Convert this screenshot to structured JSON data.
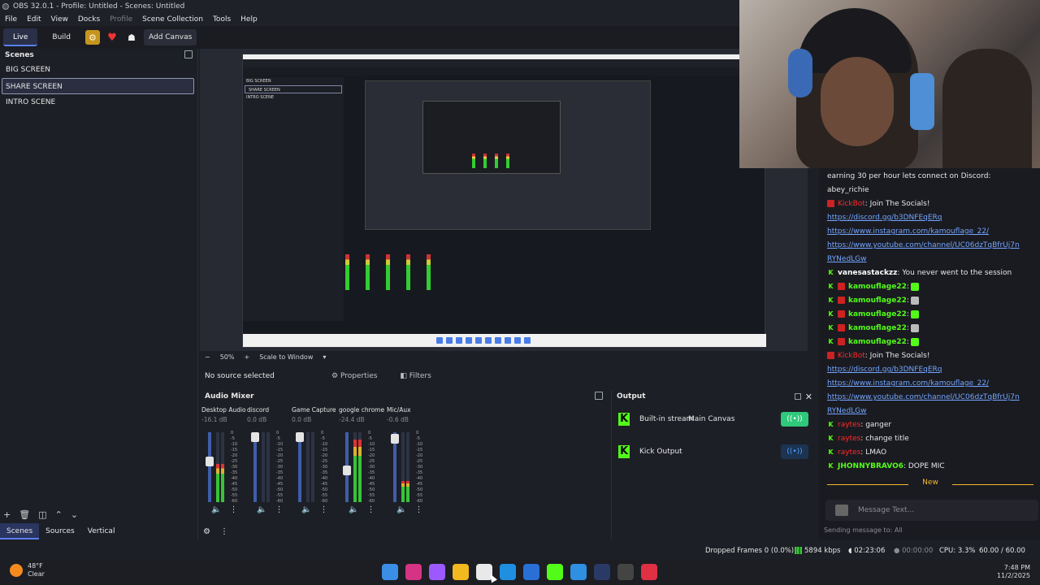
{
  "window": {
    "title": "OBS 32.0.1 - Profile: Untitled - Scenes: Untitled"
  },
  "menu": [
    "File",
    "Edit",
    "View",
    "Docks",
    "Profile",
    "Scene Collection",
    "Tools",
    "Help"
  ],
  "modes": {
    "live": "Live",
    "build": "Build",
    "add_canvas": "Add Canvas"
  },
  "scenes": {
    "header": "Scenes",
    "items": [
      "BIG SCREEN",
      "SHARE SCREEN",
      "INTRO SCENE"
    ],
    "selected_index": 1
  },
  "dock_tabs": [
    "Scenes",
    "Sources",
    "Vertical"
  ],
  "preview": {
    "zoom": "50%",
    "scale_mode": "Scale to Window",
    "nested_scenes": [
      "BIG SCREEN",
      "SHARE SCREEN",
      "INTRO SCENE"
    ]
  },
  "source_bar": {
    "no_source": "No source selected",
    "properties": "Properties",
    "filters": "Filters"
  },
  "mixer": {
    "header": "Audio Mixer",
    "channels": [
      {
        "name": "Desktop Audio",
        "db": "-16.1 dB",
        "level": 0.55,
        "fader": 0.6
      },
      {
        "name": "discord",
        "db": "0.0 dB",
        "level": 0.0,
        "fader": 1.0
      },
      {
        "name": "Game Capture",
        "db": "0.0 dB",
        "level": 0.0,
        "fader": 1.0
      },
      {
        "name": "google chrome",
        "db": "-24.4 dB",
        "level": 0.9,
        "fader": 0.45
      },
      {
        "name": "Mic/Aux",
        "db": "-0.6 dB",
        "level": 0.3,
        "fader": 0.97
      }
    ],
    "scale": [
      "0",
      "-5",
      "-10",
      "-15",
      "-20",
      "-25",
      "-30",
      "-35",
      "-40",
      "-45",
      "-50",
      "-55",
      "-60"
    ]
  },
  "output": {
    "header": "Output",
    "rows": [
      {
        "name": "Built-in stream",
        "canvas": "Main Canvas",
        "state": "on"
      },
      {
        "name": "Kick Output",
        "canvas": "",
        "state": "off"
      }
    ]
  },
  "chat": {
    "lines": [
      {
        "kind": "text",
        "text": "earning 30 per hour lets connect on Discord:"
      },
      {
        "kind": "text",
        "text": "abey_richie"
      },
      {
        "kind": "msg",
        "badge": "bot",
        "user": "KickBot",
        "ucolor": "user-red",
        "text": ": Join The Socials!"
      },
      {
        "kind": "link",
        "text": "https://discord.gg/b3DNFEqERq"
      },
      {
        "kind": "link",
        "text": "https://www.instagram.com/kamouflage_22/"
      },
      {
        "kind": "link",
        "text": "https://www.youtube.com/channel/UC06dzTqBfrUj7n"
      },
      {
        "kind": "link",
        "text": "RYNedLGw"
      },
      {
        "kind": "msg",
        "badge": "k",
        "user": "vanesastackzz",
        "ucolor": "user-white",
        "text": ": You never went to the session"
      },
      {
        "kind": "msg",
        "badge": "kb",
        "user": "kamouflage22",
        "ucolor": "user-green",
        "text": ":",
        "emote": "green"
      },
      {
        "kind": "msg",
        "badge": "kb",
        "user": "kamouflage22",
        "ucolor": "user-green",
        "text": ":",
        "emote": "gray"
      },
      {
        "kind": "msg",
        "badge": "kb",
        "user": "kamouflage22",
        "ucolor": "user-green",
        "text": ":",
        "emote": "green"
      },
      {
        "kind": "msg",
        "badge": "kb",
        "user": "kamouflage22",
        "ucolor": "user-green",
        "text": ":",
        "emote": "gray"
      },
      {
        "kind": "msg",
        "badge": "kb",
        "user": "kamouflage22",
        "ucolor": "user-green",
        "text": ":",
        "emote": "green"
      },
      {
        "kind": "msg",
        "badge": "bot",
        "user": "KickBot",
        "ucolor": "user-red",
        "text": ": Join The Socials!"
      },
      {
        "kind": "link",
        "text": "https://discord.gg/b3DNFEqERq"
      },
      {
        "kind": "link",
        "text": "https://www.instagram.com/kamouflage_22/"
      },
      {
        "kind": "link",
        "text": "https://www.youtube.com/channel/UC06dzTqBfrUj7n"
      },
      {
        "kind": "link",
        "text": "RYNedLGw"
      },
      {
        "kind": "msg",
        "badge": "k",
        "user": "raytes",
        "ucolor": "user-red",
        "text": ": ganger"
      },
      {
        "kind": "msg",
        "badge": "k",
        "user": "raytes",
        "ucolor": "user-red",
        "text": ": change title"
      },
      {
        "kind": "msg",
        "badge": "k",
        "user": "raytes",
        "ucolor": "user-red",
        "text": ": LMAO"
      },
      {
        "kind": "msg",
        "badge": "k",
        "user": "JHONNYBRAVO6",
        "ucolor": "user-green",
        "text": ": DOPE MIC"
      }
    ],
    "new_divider": "New",
    "input_placeholder": "Message Text...",
    "sending_to": "Sending message to: All"
  },
  "status": {
    "dropped": "Dropped Frames 0 (0.0%)",
    "kbps": "5894 kbps",
    "stream_time": "02:23:06",
    "rec_time": "00:00:00",
    "cpu": "CPU: 3.3%",
    "fps": "60.00 / 60.00 FPS"
  },
  "taskbar": {
    "weather_temp": "48°F",
    "weather_desc": "Clear",
    "time": "7:48 PM",
    "date": "11/2/2025",
    "icon_colors": [
      "#3a8ee6",
      "#d63384",
      "#9b59ff",
      "#f2b820",
      "#e9e9e9",
      "#1f8fe0",
      "#2a6fd6",
      "#53fc18",
      "#2f8fe0",
      "#2a3a66",
      "#444444",
      "#e03044"
    ]
  }
}
